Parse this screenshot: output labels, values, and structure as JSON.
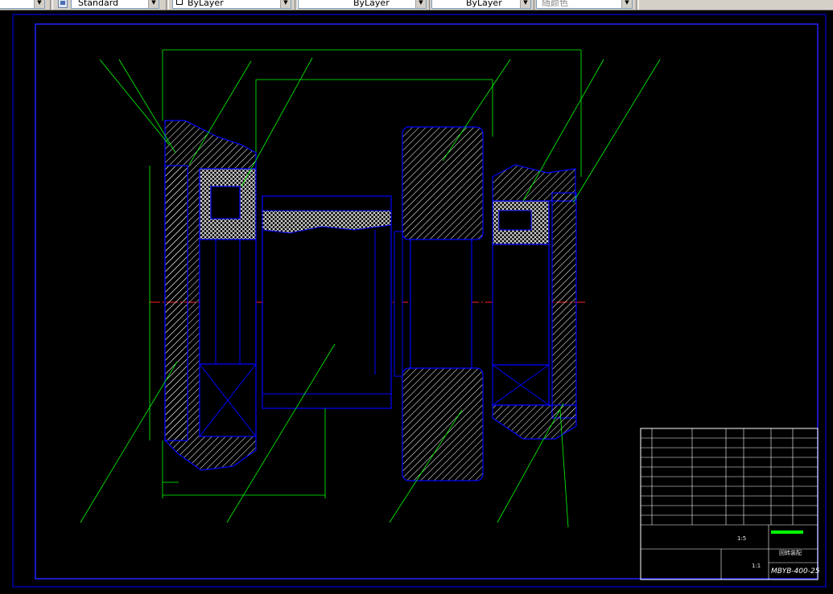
{
  "toolbar": {
    "text_style_value": "Standard",
    "layer_value": "ByLayer",
    "linetype_value": "ByLayer",
    "lineweight_value": "ByLayer",
    "color_value": "随颜色"
  },
  "drawing": {
    "title_block": {
      "drawing_number": "MBYB-400-25",
      "scale": "1:5",
      "sheet": "1:1",
      "drawing_name": "回转装配"
    },
    "colors": {
      "frame": "#0000ff",
      "outline": "#0000ff",
      "hatch": "#ffffff",
      "leader": "#00ff00",
      "centerline": "#ff0000",
      "dimension": "#00ff00"
    }
  }
}
